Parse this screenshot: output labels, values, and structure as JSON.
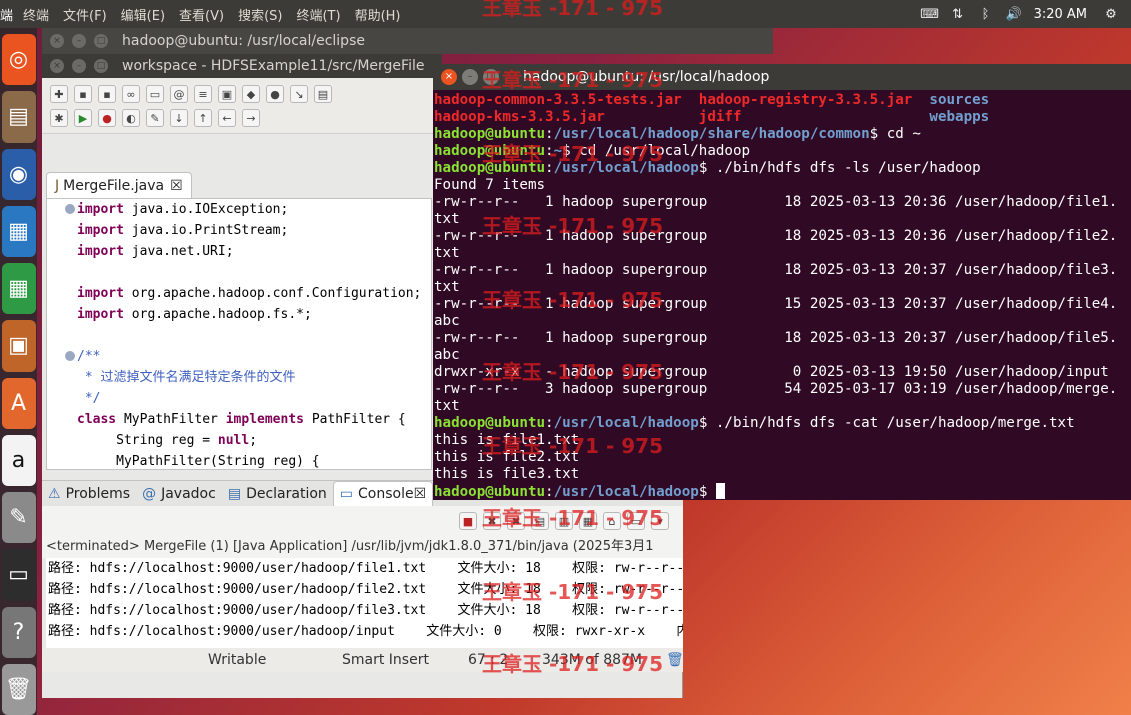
{
  "topbar": {
    "app_name": "端",
    "menu": [
      "终端",
      "文件(F)",
      "编辑(E)",
      "查看(V)",
      "搜索(S)",
      "终端(T)",
      "帮助(H)"
    ],
    "clock": "3:20 AM"
  },
  "eclipse": {
    "window1_title": "hadoop@ubuntu: /usr/local/eclipse",
    "window2_title": "workspace - HDFSExample11/src/MergeFile",
    "editor_tab": "MergeFile.java",
    "code_lines": [
      "import java.io.IOException;",
      "import java.io.PrintStream;",
      "import java.net.URI;",
      "",
      "import org.apache.hadoop.conf.Configuration;",
      "import org.apache.hadoop.fs.*;",
      "",
      "/**",
      " * 过滤掉文件名满足特定条件的文件",
      " */",
      "class MyPathFilter implements PathFilter {",
      "     String reg = null;",
      "     MyPathFilter(String reg) {"
    ],
    "console_tabs": [
      "Problems",
      "Javadoc",
      "Declaration",
      "Console"
    ],
    "console_status": "<terminated> MergeFile (1) [Java Application] /usr/lib/jvm/jdk1.8.0_371/bin/java (2025年3月1",
    "console_lines": [
      "路径: hdfs://localhost:9000/user/hadoop/file1.txt    文件大小: 18    权限: rw-r--r--",
      "路径: hdfs://localhost:9000/user/hadoop/file2.txt    文件大小: 18    权限: rw-r--r--",
      "路径: hdfs://localhost:9000/user/hadoop/file3.txt    文件大小: 18    权限: rw-r--r--",
      "路径: hdfs://localhost:9000/user/hadoop/input    文件大小: 0    权限: rwxr-xr-x    内"
    ],
    "status_writable": "Writable",
    "status_insert": "Smart Insert",
    "status_pos": "67 : 2",
    "status_mem": "343M of 887M"
  },
  "terminal": {
    "title": "hadoop@ubuntu: /usr/local/hadoop",
    "lines": [
      {
        "segs": [
          [
            "r",
            "hadoop-common-3.3.5-tests.jar  hadoop-registry-3.3.5.jar  "
          ],
          [
            "b",
            "sources"
          ]
        ]
      },
      {
        "segs": [
          [
            "r",
            "hadoop-kms-3.3.5.jar           jdiff                      "
          ],
          [
            "b",
            "webapps"
          ]
        ]
      },
      {
        "segs": [
          [
            "g",
            "hadoop@ubuntu"
          ],
          [
            "w",
            ":"
          ],
          [
            "b",
            "/usr/local/hadoop/share/hadoop/common"
          ],
          [
            "w",
            "$ cd ~"
          ]
        ]
      },
      {
        "segs": [
          [
            "g",
            "hadoop@ubuntu"
          ],
          [
            "w",
            ":"
          ],
          [
            "b",
            "~"
          ],
          [
            "w",
            "$ cd /usr/local/hadoop"
          ]
        ]
      },
      {
        "segs": [
          [
            "g",
            "hadoop@ubuntu"
          ],
          [
            "w",
            ":"
          ],
          [
            "b",
            "/usr/local/hadoop"
          ],
          [
            "w",
            "$ ./bin/hdfs dfs -ls /user/hadoop"
          ]
        ]
      },
      {
        "segs": [
          [
            "w",
            "Found 7 items"
          ]
        ]
      },
      {
        "segs": [
          [
            "w",
            "-rw-r--r--   1 hadoop supergroup         18 2025-03-13 20:36 /user/hadoop/file1."
          ]
        ]
      },
      {
        "segs": [
          [
            "w",
            "txt"
          ]
        ]
      },
      {
        "segs": [
          [
            "w",
            "-rw-r--r--   1 hadoop supergroup         18 2025-03-13 20:36 /user/hadoop/file2."
          ]
        ]
      },
      {
        "segs": [
          [
            "w",
            "txt"
          ]
        ]
      },
      {
        "segs": [
          [
            "w",
            "-rw-r--r--   1 hadoop supergroup         18 2025-03-13 20:37 /user/hadoop/file3."
          ]
        ]
      },
      {
        "segs": [
          [
            "w",
            "txt"
          ]
        ]
      },
      {
        "segs": [
          [
            "w",
            "-rw-r--r--   1 hadoop supergroup         15 2025-03-13 20:37 /user/hadoop/file4."
          ]
        ]
      },
      {
        "segs": [
          [
            "w",
            "abc"
          ]
        ]
      },
      {
        "segs": [
          [
            "w",
            "-rw-r--r--   1 hadoop supergroup         18 2025-03-13 20:37 /user/hadoop/file5."
          ]
        ]
      },
      {
        "segs": [
          [
            "w",
            "abc"
          ]
        ]
      },
      {
        "segs": [
          [
            "w",
            "drwxr-xr-x   - hadoop supergroup          0 2025-03-13 19:50 /user/hadoop/input"
          ]
        ]
      },
      {
        "segs": [
          [
            "w",
            "-rw-r--r--   3 hadoop supergroup         54 2025-03-17 03:19 /user/hadoop/merge."
          ]
        ]
      },
      {
        "segs": [
          [
            "w",
            "txt"
          ]
        ]
      },
      {
        "segs": [
          [
            "g",
            "hadoop@ubuntu"
          ],
          [
            "w",
            ":"
          ],
          [
            "b",
            "/usr/local/hadoop"
          ],
          [
            "w",
            "$ ./bin/hdfs dfs -cat /user/hadoop/merge.txt"
          ]
        ]
      },
      {
        "segs": [
          [
            "w",
            "this is file1.txt"
          ]
        ]
      },
      {
        "segs": [
          [
            "w",
            "this is file2.txt"
          ]
        ]
      },
      {
        "segs": [
          [
            "w",
            "this is file3.txt"
          ]
        ]
      },
      {
        "segs": [
          [
            "g",
            "hadoop@ubuntu"
          ],
          [
            "w",
            ":"
          ],
          [
            "b",
            "/usr/local/hadoop"
          ],
          [
            "w",
            "$ "
          ]
        ],
        "cursor": true
      }
    ]
  },
  "watermark": "王章玉 -171 - 975"
}
